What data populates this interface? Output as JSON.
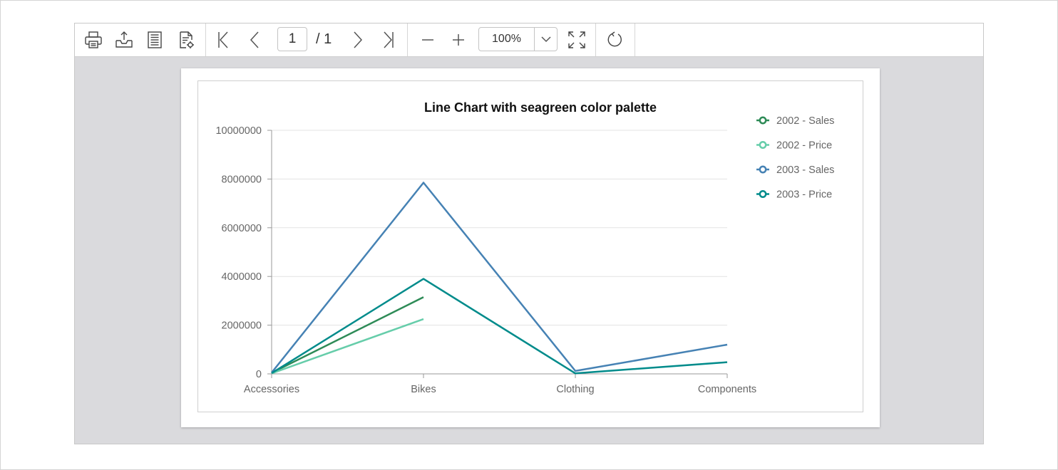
{
  "toolbar": {
    "icons": [
      "print-icon",
      "export-icon",
      "page-setup-icon",
      "parameters-icon",
      "first-page-icon",
      "previous-page-icon",
      "next-page-icon",
      "last-page-icon",
      "zoom-out-icon",
      "zoom-in-icon",
      "chevron-down-icon",
      "fit-page-icon",
      "refresh-icon"
    ],
    "current_page": "1",
    "total_pages": "/ 1",
    "zoom": "100%"
  },
  "colors": {
    "viewer_background": "#dadadd",
    "series": [
      "#2e8b57",
      "#66cdaa",
      "#4682b4",
      "#008b8b"
    ]
  },
  "chart_data": {
    "type": "line",
    "title": "Line Chart with seagreen color palette",
    "categories": [
      "Accessories",
      "Bikes",
      "Clothing",
      "Components"
    ],
    "yticks": [
      "10000000",
      "8000000",
      "6000000",
      "4000000",
      "2000000",
      "0"
    ],
    "ylim": [
      0,
      10000000
    ],
    "grid": true,
    "legend_position": "top-right",
    "series": [
      {
        "name": "2002 - Sales",
        "color": "#2e8b57",
        "values": [
          40000,
          3150000,
          null,
          null
        ]
      },
      {
        "name": "2002 - Price",
        "color": "#66cdaa",
        "values": [
          20000,
          2250000,
          null,
          null
        ]
      },
      {
        "name": "2003 - Sales",
        "color": "#4682b4",
        "values": [
          50000,
          7850000,
          120000,
          1200000
        ]
      },
      {
        "name": "2003 - Price",
        "color": "#008b8b",
        "values": [
          30000,
          3900000,
          20000,
          480000
        ]
      }
    ]
  }
}
